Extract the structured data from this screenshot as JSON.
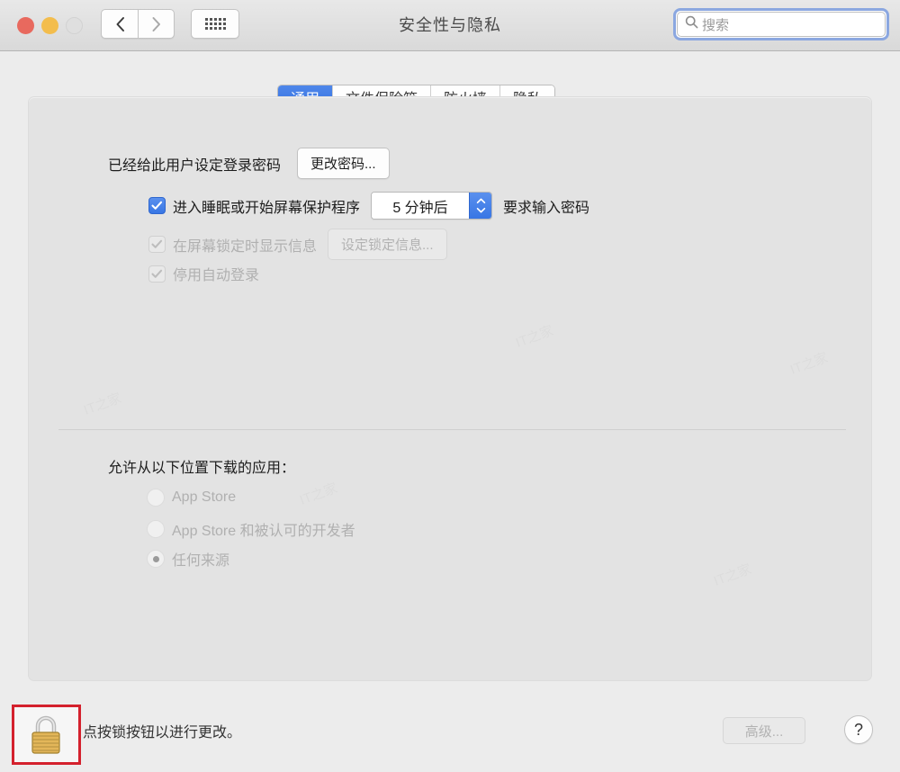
{
  "window": {
    "title": "安全性与隐私"
  },
  "toolbar": {
    "back_icon": "chevron-left-icon",
    "forward_icon": "chevron-right-icon",
    "grid_icon": "grid-view-icon",
    "search_placeholder": "搜索",
    "search_value": "",
    "search_icon": "search-icon"
  },
  "tabs": [
    {
      "label": "通用",
      "active": true
    },
    {
      "label": "文件保险箱",
      "active": false
    },
    {
      "label": "防火墙",
      "active": false
    },
    {
      "label": "隐私",
      "active": false
    }
  ],
  "general": {
    "password_status": "已经给此用户设定登录密码",
    "change_password_button": "更改密码...",
    "require_password": {
      "checked": true,
      "enabled": true,
      "label_before": "进入睡眠或开始屏幕保护程序",
      "delay_value": "5 分钟后",
      "label_after": "要求输入密码"
    },
    "show_message": {
      "checked": true,
      "enabled": false,
      "label": "在屏幕锁定时显示信息",
      "button": "设定锁定信息..."
    },
    "disable_auto_login": {
      "checked": true,
      "enabled": false,
      "label": "停用自动登录"
    }
  },
  "download_section": {
    "heading": "允许从以下位置下载的应用：",
    "options": [
      {
        "label": "App Store",
        "selected": false,
        "enabled": false
      },
      {
        "label": "App Store 和被认可的开发者",
        "selected": false,
        "enabled": false
      },
      {
        "label": "任何来源",
        "selected": true,
        "enabled": false
      }
    ]
  },
  "bottom_bar": {
    "lock_icon": "lock-closed-icon",
    "lock_hint": "点按锁按钮以进行更改。",
    "advanced_button": "高级...",
    "help_button": "?",
    "highlight_color": "#d4212d"
  },
  "colors": {
    "accent_blue": "#3876e4",
    "window_bg": "#ececec",
    "panel_bg": "#e3e3e3",
    "title_text": "#4a4a4a",
    "disabled_text": "#b0b0b0"
  }
}
